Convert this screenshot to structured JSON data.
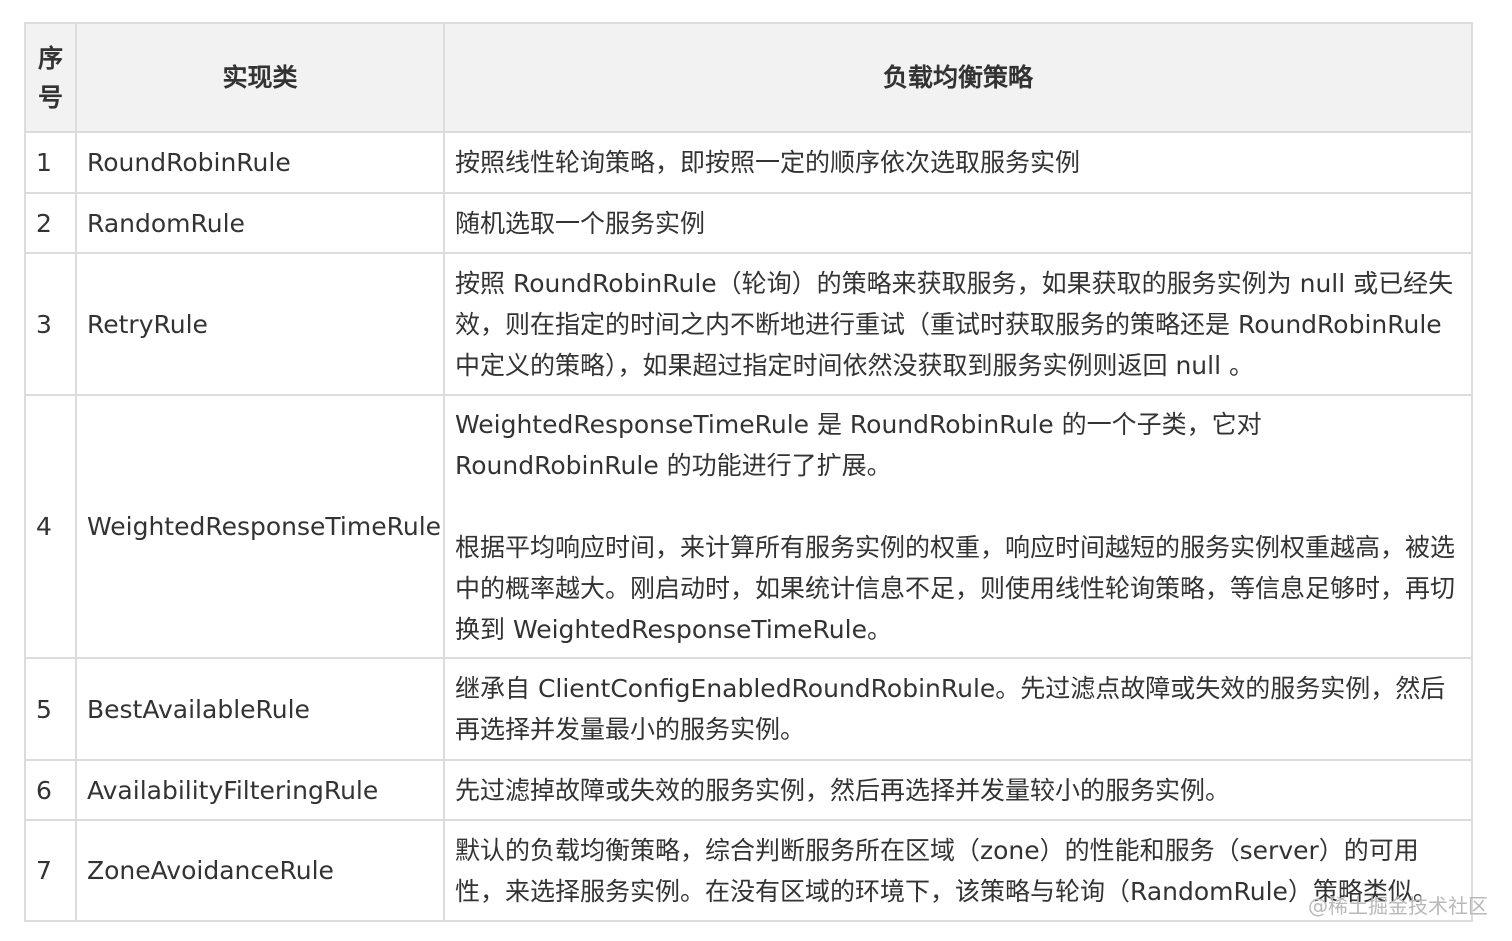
{
  "table": {
    "headers": {
      "num": "序号",
      "class": "实现类",
      "strategy": "负载均衡策略"
    },
    "rows": [
      {
        "num": "1",
        "class": "RoundRobinRule",
        "desc": [
          "按照线性轮询策略，即按照一定的顺序依次选取服务实例"
        ]
      },
      {
        "num": "2",
        "class": "RandomRule",
        "desc": [
          "随机选取一个服务实例"
        ]
      },
      {
        "num": "3",
        "class": "RetryRule",
        "desc": [
          "按照 RoundRobinRule（轮询）的策略来获取服务，如果获取的服务实例为 null 或已经失效，则在指定的时间之内不断地进行重试（重试时获取服务的策略还是 RoundRobinRule 中定义的策略），如果超过指定时间依然没获取到服务实例则返回 null 。"
        ]
      },
      {
        "num": "4",
        "class": "WeightedResponseTimeRule",
        "desc": [
          "WeightedResponseTimeRule 是 RoundRobinRule 的一个子类，它对 RoundRobinRule 的功能进行了扩展。",
          "根据平均响应时间，来计算所有服务实例的权重，响应时间越短的服务实例权重越高，被选中的概率越大。刚启动时，如果统计信息不足，则使用线性轮询策略，等信息足够时，再切换到 WeightedResponseTimeRule。"
        ]
      },
      {
        "num": "5",
        "class": "BestAvailableRule",
        "desc": [
          "继承自 ClientConfigEnabledRoundRobinRule。先过滤点故障或失效的服务实例，然后再选择并发量最小的服务实例。"
        ]
      },
      {
        "num": "6",
        "class": "AvailabilityFilteringRule",
        "desc": [
          "先过滤掉故障或失效的服务实例，然后再选择并发量较小的服务实例。"
        ]
      },
      {
        "num": "7",
        "class": "ZoneAvoidanceRule",
        "desc": [
          "默认的负载均衡策略，综合判断服务所在区域（zone）的性能和服务（server）的可用性，来选择服务实例。在没有区域的环境下，该策略与轮询（RandomRule）策略类似。"
        ]
      }
    ]
  },
  "watermark": "@稀土掘金技术社区"
}
